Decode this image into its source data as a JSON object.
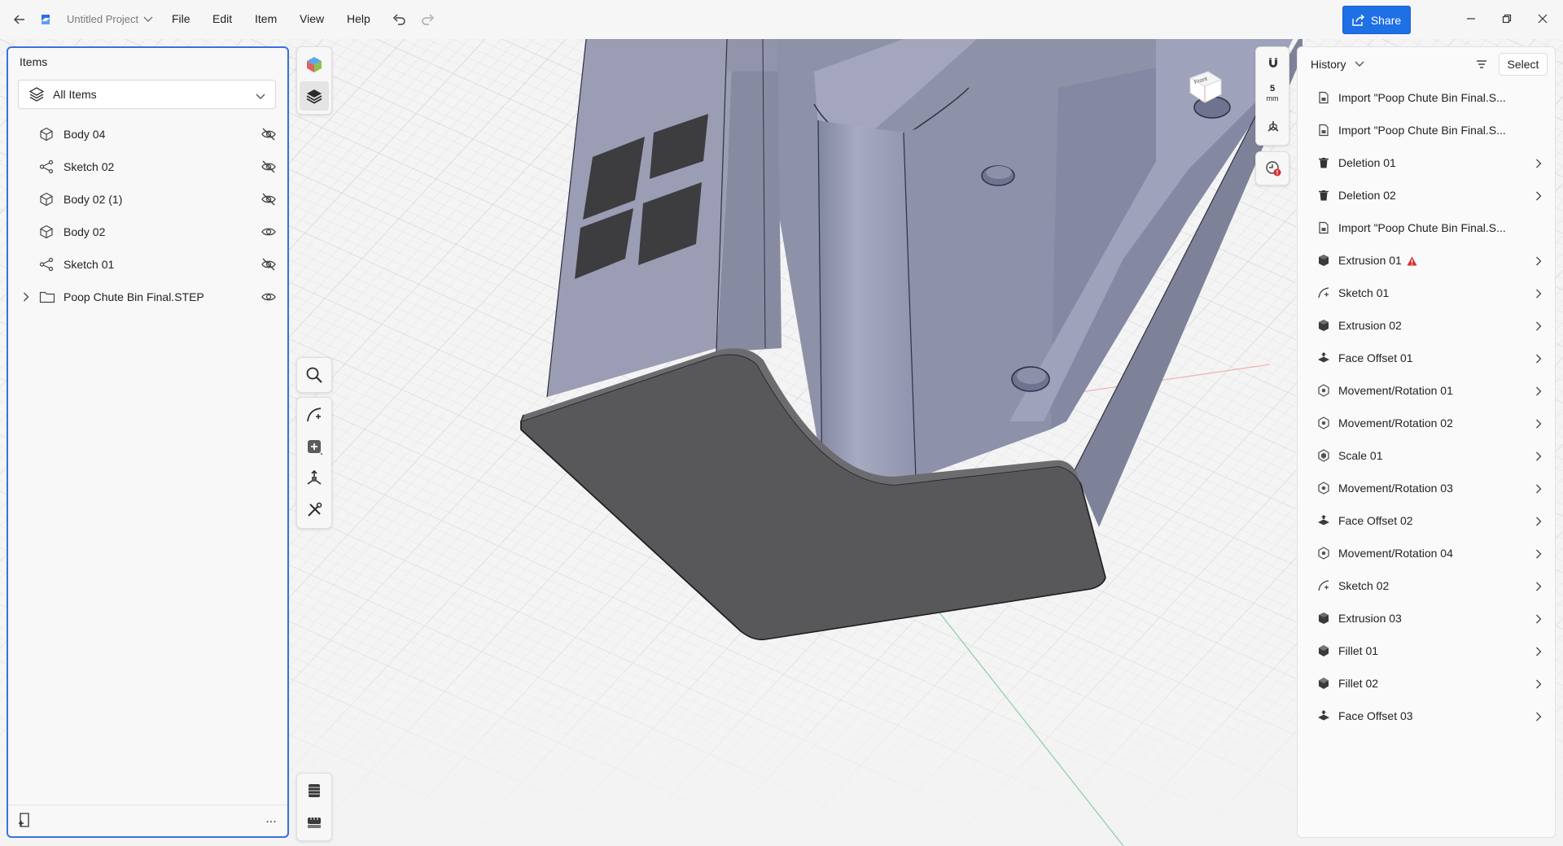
{
  "titlebar": {
    "project_name": "Untitled Project",
    "menu": [
      "File",
      "Edit",
      "Item",
      "View",
      "Help"
    ],
    "share_label": "Share"
  },
  "items_panel": {
    "title": "Items",
    "filter_label": "All Items",
    "items": [
      {
        "label": "Body 04",
        "icon": "body-icon",
        "visible": false
      },
      {
        "label": "Sketch 02",
        "icon": "sketch-icon",
        "visible": false
      },
      {
        "label": "Body 02 (1)",
        "icon": "body-icon",
        "visible": false
      },
      {
        "label": "Body 02",
        "icon": "body-icon",
        "visible": true
      },
      {
        "label": "Sketch 01",
        "icon": "sketch-icon",
        "visible": false
      },
      {
        "label": "Poop Chute Bin Final.STEP",
        "icon": "folder-icon",
        "visible": true,
        "expandable": true
      }
    ],
    "more_label": "..."
  },
  "viewport": {
    "scale_label": "5",
    "scale_unit": "mm",
    "view_cube_label": "Front"
  },
  "history_panel": {
    "title": "History",
    "select_label": "Select",
    "items": [
      {
        "label": "Import \"Poop Chute Bin Final.S...",
        "icon": "import-icon",
        "has_children": false
      },
      {
        "label": "Import \"Poop Chute Bin Final.S...",
        "icon": "import-icon",
        "has_children": false
      },
      {
        "label": "Deletion 01",
        "icon": "trash-icon",
        "has_children": true
      },
      {
        "label": "Deletion 02",
        "icon": "trash-icon",
        "has_children": true
      },
      {
        "label": "Import \"Poop Chute Bin Final.S...",
        "icon": "import-icon",
        "has_children": false
      },
      {
        "label": "Extrusion 01",
        "icon": "extrusion-icon",
        "has_children": true,
        "warning": true
      },
      {
        "label": "Sketch 01",
        "icon": "sketch-curve-icon",
        "has_children": true
      },
      {
        "label": "Extrusion 02",
        "icon": "extrusion-icon",
        "has_children": true
      },
      {
        "label": "Face Offset 01",
        "icon": "face-offset-icon",
        "has_children": true
      },
      {
        "label": "Movement/Rotation 01",
        "icon": "movement-icon",
        "has_children": true
      },
      {
        "label": "Movement/Rotation 02",
        "icon": "movement-icon",
        "has_children": true
      },
      {
        "label": "Scale 01",
        "icon": "scale-icon",
        "has_children": true
      },
      {
        "label": "Movement/Rotation 03",
        "icon": "movement-icon",
        "has_children": true
      },
      {
        "label": "Face Offset 02",
        "icon": "face-offset-icon",
        "has_children": true
      },
      {
        "label": "Movement/Rotation 04",
        "icon": "movement-icon",
        "has_children": true
      },
      {
        "label": "Sketch 02",
        "icon": "sketch-curve-icon",
        "has_children": true
      },
      {
        "label": "Extrusion 03",
        "icon": "extrusion-icon",
        "has_children": true
      },
      {
        "label": "Fillet 01",
        "icon": "fillet-icon",
        "has_children": true
      },
      {
        "label": "Fillet 02",
        "icon": "fillet-icon",
        "has_children": true
      },
      {
        "label": "Face Offset 03",
        "icon": "face-offset-icon",
        "has_children": true
      }
    ]
  },
  "colors": {
    "accent": "#1f6fe5",
    "model_body": "#8f93a8",
    "model_base": "#4e4e50",
    "warning": "#d32f2f"
  }
}
